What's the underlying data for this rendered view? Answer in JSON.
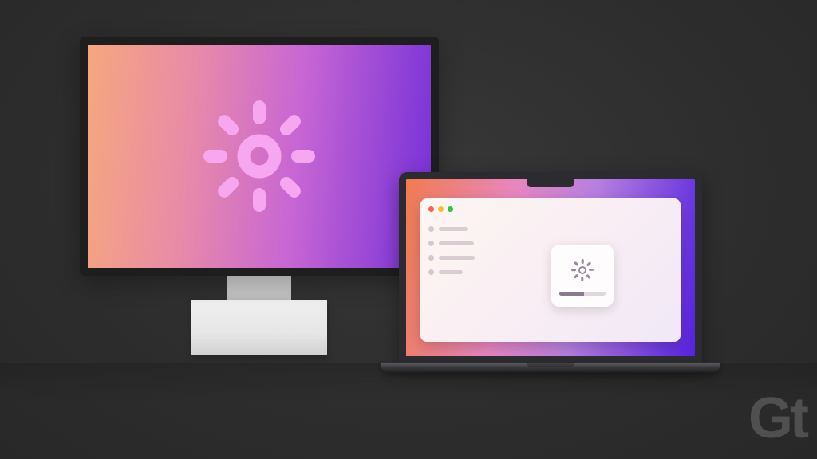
{
  "illustration": {
    "big_icon": "brightness-sun",
    "hud_icon": "brightness-sun",
    "brightness_percent": 55,
    "sidebar_item_widths": [
      36,
      44,
      48,
      30
    ]
  },
  "watermark": "Gt",
  "colors": {
    "bg": "#2c2c2c",
    "grad_start": "#f6a77e",
    "grad_end": "#7631d8",
    "sun": "#f6a7f0"
  }
}
